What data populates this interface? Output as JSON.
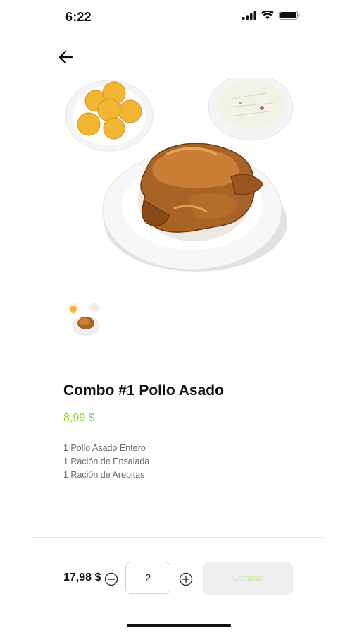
{
  "status_bar": {
    "time": "6:22",
    "icons": [
      "signal-icon",
      "wifi-icon",
      "battery-icon"
    ]
  },
  "navigation": {
    "back_icon": "arrow-left-icon"
  },
  "product": {
    "image_alt": "Combo #1 Pollo Asado",
    "thumbnails": [
      "thumbnail-combo"
    ],
    "title": "Combo #1 Pollo Asado",
    "price": "8,99 $",
    "description": [
      "1 Pollo Asado Entero",
      "1 Ración de Ensalada",
      "1 Ración de Arepitas"
    ]
  },
  "cart_bar": {
    "total": "17,98 $",
    "quantity": "2",
    "minus_icon": "minus-circle-icon",
    "plus_icon": "plus-circle-icon",
    "buy_label": "Comprar"
  },
  "colors": {
    "accent": "#7ed321",
    "text": "#111111",
    "muted": "#6b6b6b",
    "button_bg": "#efefef"
  }
}
